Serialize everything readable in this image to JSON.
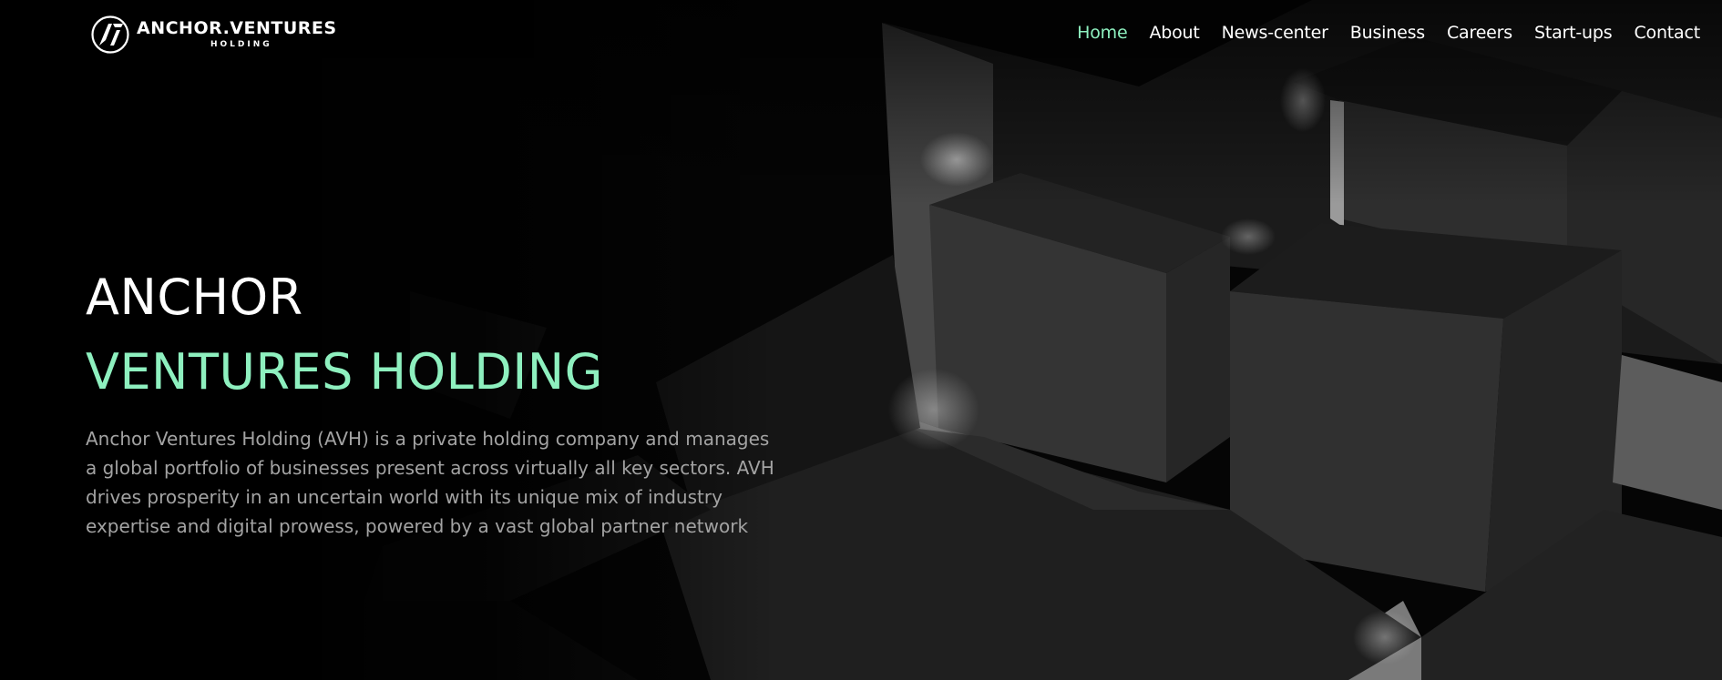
{
  "brand": {
    "name": "ANCHOR.VENTURES",
    "sub": "HOLDING",
    "accent_color": "#8ef0bf"
  },
  "nav": {
    "items": [
      {
        "label": "Home",
        "active": true
      },
      {
        "label": "About",
        "active": false
      },
      {
        "label": "News-center",
        "active": false
      },
      {
        "label": "Business",
        "active": false
      },
      {
        "label": "Careers",
        "active": false
      },
      {
        "label": "Start-ups",
        "active": false
      },
      {
        "label": "Contact",
        "active": false
      }
    ]
  },
  "hero": {
    "title_line1": "ANCHOR",
    "title_line2": "VENTURES HOLDING",
    "description": "Anchor Ventures Holding (AVH) is a private holding company and manages a global portfolio of businesses present across virtually all key sectors. AVH drives prosperity in an uncertain world with its unique mix of industry expertise and digital prowess, powered by a vast global partner network"
  }
}
